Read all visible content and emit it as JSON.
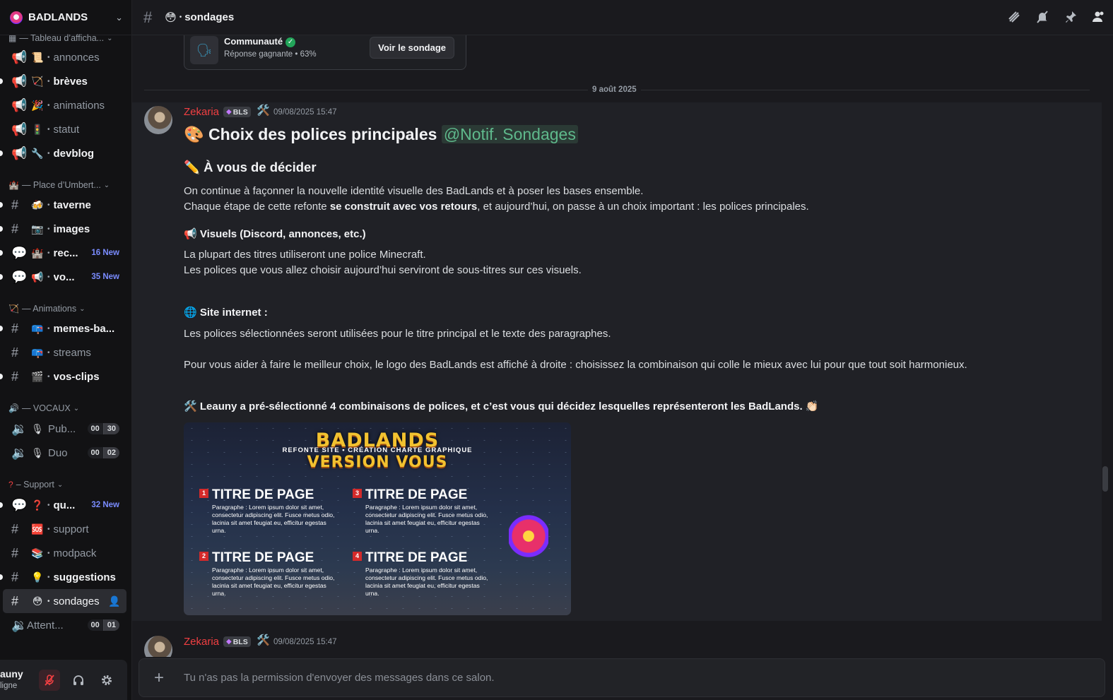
{
  "server": {
    "name": "BADLANDS"
  },
  "sidebar": {
    "categories": {
      "tableau": "— Tableau d’afficha...",
      "place": "— Place d’Umbert...",
      "animations": "— Animations",
      "vocaux": "— VOCAUX",
      "support": "– Support"
    },
    "channels": {
      "annonces": {
        "emoji": "📜",
        "name": "annonces"
      },
      "breves": {
        "emoji": "🏹",
        "name": "brèves"
      },
      "animations": {
        "emoji": "🎉",
        "name": "animations"
      },
      "statut": {
        "emoji": "🚦",
        "name": "statut"
      },
      "devblog": {
        "emoji": "🔧",
        "name": "devblog"
      },
      "taverne": {
        "emoji": "🍻",
        "name": "taverne"
      },
      "images": {
        "emoji": "📷",
        "name": "images"
      },
      "rec": {
        "emoji": "🏰",
        "name": "rec...",
        "badge": "16 New"
      },
      "vo": {
        "emoji": "📢",
        "name": "vo...",
        "badge": "35 New"
      },
      "memes": {
        "emoji": "📪",
        "name": "memes-ba..."
      },
      "streams": {
        "emoji": "📪",
        "name": "streams"
      },
      "clips": {
        "emoji": "🎬",
        "name": "vos-clips"
      },
      "pub": {
        "emoji": "🎙",
        "name": "Pub...",
        "count_a": "00",
        "count_b": "30"
      },
      "duo": {
        "emoji": "🎙",
        "name": "Duo",
        "count_a": "00",
        "count_b": "02"
      },
      "qu": {
        "emoji": "❓",
        "name": "qu...",
        "badge": "32 New"
      },
      "support": {
        "emoji": "🆘",
        "name": "support"
      },
      "modpack": {
        "emoji": "📚",
        "name": "modpack"
      },
      "suggestions": {
        "emoji": "💡",
        "name": "suggestions"
      },
      "sondages": {
        "emoji": "😳",
        "name": "sondages"
      },
      "attent": {
        "name": "Attent...",
        "count_a": "00",
        "count_b": "01"
      }
    }
  },
  "user_panel": {
    "name": "auny",
    "status": "ligne"
  },
  "topbar": {
    "channel_emoji": "😳",
    "channel_name": "sondages"
  },
  "poll_result": {
    "title": "Communauté",
    "subtitle": "Réponse gagnante • 63%",
    "button": "Voir le sondage"
  },
  "date_divider": "9 août 2025",
  "message": {
    "author": "Zekaria",
    "tag": "BLS",
    "timestamp": "09/08/2025 15:47",
    "title": "🎨 Choix des polices principales",
    "mention": "@Notif. Sondages",
    "subtitle": "✏️ À vous de décider",
    "p1_line1": "On continue à façonner la nouvelle identité visuelle des BadLands et à poser les bases ensemble.",
    "p1_line2_a": "Chaque étape de cette refonte ",
    "p1_line2_bold": "se construit avec vos retours",
    "p1_line2_b": ", et aujourd’hui, on passe à un choix important : les polices principales.",
    "section1": "📢 Visuels (Discord, annonces, etc.)",
    "p2_line1": "La plupart des titres utiliseront une police Minecraft.",
    "p2_line2": "Les polices que vous allez choisir aujourd’hui serviront de sous-titres sur ces visuels.",
    "section2": "🌐 Site internet :",
    "p3": "Les polices sélectionnées seront utilisées pour le titre principal et le texte des paragraphes.",
    "p4": "Pour vous aider à faire le meilleur choix, le logo des BadLands est affiché à droite : choisissez la combinaison qui colle le mieux avec lui pour que tout soit harmonieux.",
    "section3": "🛠️ Leauny a pré-sélectionné 4 combinaisons de polices, et c’est vous qui décidez lesquelles représenteront les BadLands. 👏🏻"
  },
  "image": {
    "title": "BADLANDS",
    "subtitle": "REFONTE SITE • CRÉATION CHARTE GRAPHIQUE",
    "title2": "VERSION VOUS",
    "options": [
      {
        "num": "1",
        "title": "TITRE DE PAGE",
        "body": "Paragraphe : Lorem ipsum dolor sit amet, consectetur adipiscing elit. Fusce metus odio, lacinia sit amet feugiat eu, efficitur egestas urna."
      },
      {
        "num": "2",
        "title": "TITRE DE PAGE",
        "body": "Paragraphe : Lorem ipsum dolor sit amet, consectetur adipiscing elit. Fusce metus odio, lacinia sit amet feugiat eu, efficitur egestas urna."
      },
      {
        "num": "3",
        "title": "TITRE DE PAGE",
        "body": "Paragraphe : Lorem ipsum dolor sit amet, consectetur adipiscing elit. Fusce metus odio, lacinia sit amet feugiat eu, efficitur egestas urna."
      },
      {
        "num": "4",
        "title": "TITRE DE PAGE",
        "body": "Paragraphe : Lorem ipsum dolor sit amet, consectetur adipiscing elit. Fusce metus odio, lacinia sit amet feugiat eu, efficitur egestas urna."
      }
    ]
  },
  "message2": {
    "author": "Zekaria",
    "tag": "BLS",
    "timestamp": "09/08/2025 15:47"
  },
  "composer": {
    "placeholder": "Tu n'as pas la permission d'envoyer des messages dans ce salon."
  },
  "colors": {
    "author": "#f23f42",
    "new_badge": "#7a8cff",
    "mention": "#5fb98c"
  }
}
